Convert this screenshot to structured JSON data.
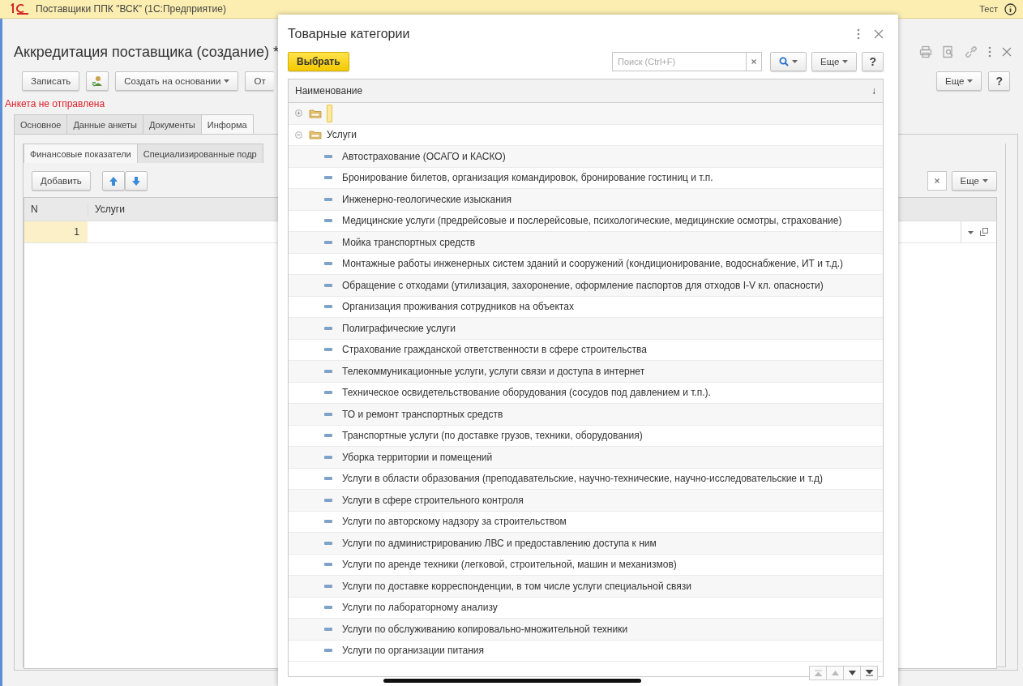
{
  "app_window": {
    "title": "Поставщики ППК \"ВСК\"  (1С:Предприятие)",
    "user": "Тест"
  },
  "form": {
    "title": "Аккредитация поставщика (создание) *",
    "toolbar": [
      "Записать",
      "Создать на основании",
      "От"
    ],
    "right_buttons": [
      "Еще",
      "?"
    ],
    "status": "Анкета не отправлена",
    "tabs": [
      {
        "label": "Основное",
        "selected": false
      },
      {
        "label": "Данные анкеты",
        "selected": false
      },
      {
        "label": "Документы",
        "selected": false
      },
      {
        "label": "Информа",
        "selected": true
      }
    ],
    "subtabs": [
      {
        "label": "Финансовые показатели",
        "selected": true
      },
      {
        "label": "Специализированные подр",
        "selected": false
      }
    ],
    "table_toolbar": {
      "add": "Добавить",
      "more": "Еще"
    },
    "table": {
      "columns": [
        "N",
        "Услуги"
      ],
      "rows": [
        {
          "n": "1",
          "selected": true
        }
      ]
    }
  },
  "dialog": {
    "title": "Товарные категории",
    "select_button": "Выбрать",
    "search": {
      "placeholder": "Поиск (Ctrl+F)"
    },
    "more_button": "Еще",
    "help_button": "?",
    "column": "Наименование",
    "sort_mark": "↓",
    "tree": [
      {
        "selected": true,
        "expanded": false
      },
      {
        "label": "Услуги",
        "selected": false,
        "expanded": true,
        "children": [
          {
            "label": "Автострахование (ОСАГО и КАСКО)",
            "selected": false
          },
          {
            "label": "Бронирование билетов, организация командировок, бронирование гостиниц и т.п.",
            "selected": false
          },
          {
            "label": "Инженерно-геологические изыскания",
            "selected": false
          },
          {
            "label": "Медицинские услуги (предрейсовые и послерейсовые, психологические, медицинские осмотры, страхование)",
            "selected": false
          },
          {
            "label": "Мойка транспортных средств",
            "selected": false
          },
          {
            "label": "Монтажные работы инженерных систем зданий и сооружений (кондиционирование, водоснабжение, ИТ и т.д.)",
            "selected": false
          },
          {
            "label": "Обращение с отходами (утилизация, захоронение, оформление паспортов для отходов I-V кл. опасности)",
            "selected": false
          },
          {
            "label": "Организация проживания сотрудников на объектах",
            "selected": false
          },
          {
            "label": "Полиграфические услуги",
            "selected": false
          },
          {
            "label": "Страхование гражданской ответственности в сфере строительства",
            "selected": false
          },
          {
            "label": "Телекоммуникационные услуги, услуги связи и доступа в интернет",
            "selected": false
          },
          {
            "label": "Техническое освидетельствование оборудования (сосудов под давлением и т.п.).",
            "selected": false
          },
          {
            "label": "ТО и ремонт транспортных средств",
            "selected": false
          },
          {
            "label": "Транспортные услуги (по доставке грузов, техники, оборудования)",
            "selected": false
          },
          {
            "label": "Уборка территории и помещений",
            "selected": false
          },
          {
            "label": "Услуги в области образования (преподавательские, научно-технические, научно-исследовательские и т.д)",
            "selected": false
          },
          {
            "label": "Услуги в сфере строительного контроля",
            "selected": false
          },
          {
            "label": "Услуги по авторскому надзору за строительством",
            "selected": false
          },
          {
            "label": "Услуги по администрированию ЛВС и предоставлению доступа к ним",
            "selected": false
          },
          {
            "label": "Услуги по аренде техники (легковой, строительной, машин и механизмов)",
            "selected": false
          },
          {
            "label": "Услуги по доставке корреспонденции, в том числе услуги специальной связи",
            "selected": false
          },
          {
            "label": "Услуги по лабораторному анализу",
            "selected": false
          },
          {
            "label": "Услуги по обслуживанию копировально-множительной техники",
            "selected": false
          },
          {
            "label": "Услуги по организации питания",
            "selected": false
          }
        ]
      }
    ]
  }
}
